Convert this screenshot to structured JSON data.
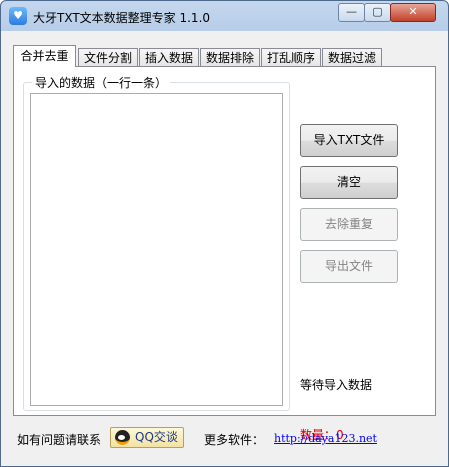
{
  "window": {
    "title": "大牙TXT文本数据整理专家 1.1.0",
    "app_icon": "tooth-icon",
    "controls": {
      "minimize": "—",
      "maximize": "▢",
      "close": "✕"
    }
  },
  "tabs": [
    {
      "label": "合并去重",
      "active": true
    },
    {
      "label": "文件分割",
      "active": false
    },
    {
      "label": "插入数据",
      "active": false
    },
    {
      "label": "数据排除",
      "active": false
    },
    {
      "label": "打乱顺序",
      "active": false
    },
    {
      "label": "数据过滤",
      "active": false
    }
  ],
  "panel": {
    "group_label": "导入的数据（一行一条）",
    "textarea_value": "",
    "buttons": {
      "import": "导入TXT文件",
      "clear": "清空",
      "dedupe": "去除重复",
      "export": "导出文件"
    },
    "status": "等待导入数据",
    "count": "数量：0"
  },
  "footer": {
    "help_text": "如有问题请联系",
    "qq_label": "QQ交谈",
    "more_label": "更多软件：",
    "site_link": "http://daya123.net"
  },
  "colors": {
    "count_text": "#e00000",
    "link": "#0000ff"
  }
}
